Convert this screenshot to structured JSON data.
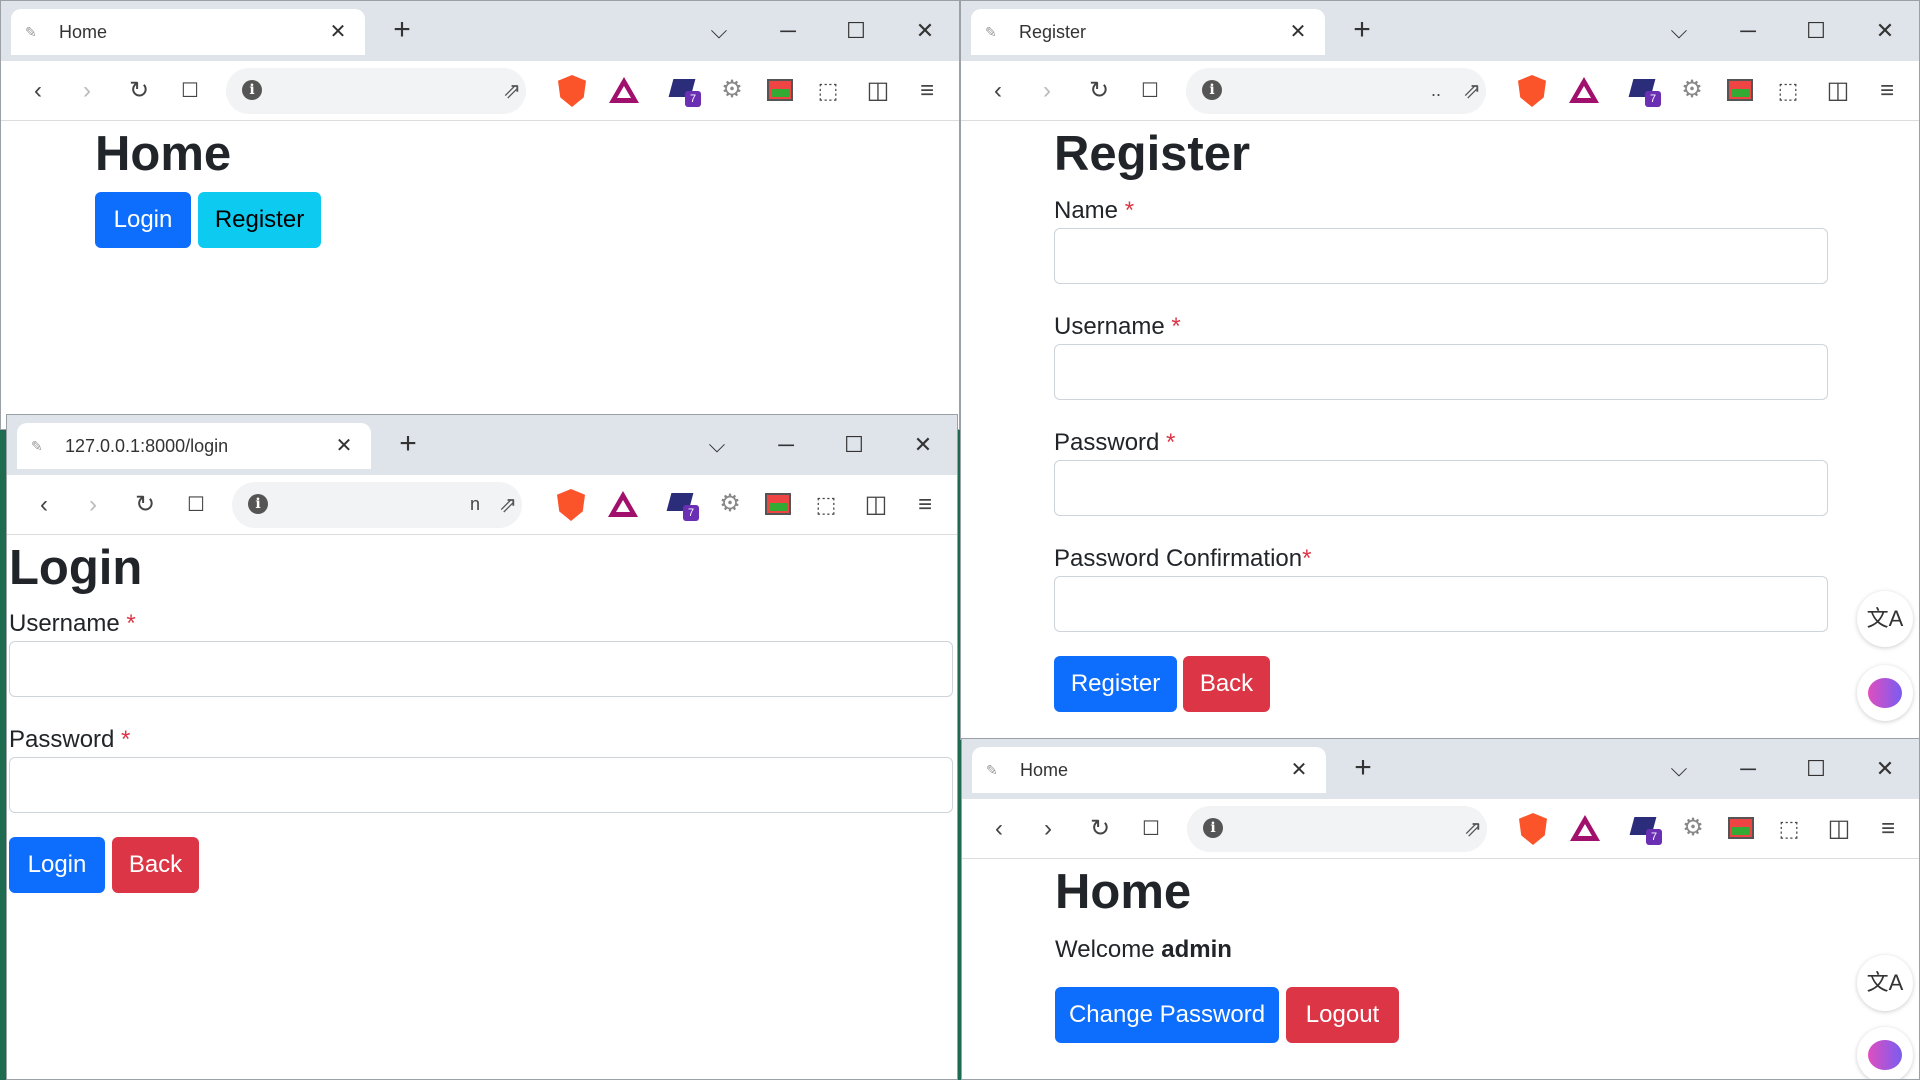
{
  "browser": {
    "new_tab": "+",
    "dropdown": "⌵",
    "minimize": "─",
    "maximize": "☐",
    "close": "✕",
    "back": "‹",
    "forward": "›",
    "reload": "↻",
    "bookmark": "🔖",
    "share": "⇗",
    "extensions": "⬚",
    "sidebar": "◫",
    "menu": "≡",
    "extension_badge": "7",
    "icons": [
      "info-icon",
      "share-icon",
      "brave-shields-icon",
      "bat-rewards-icon",
      "extension-icon",
      "gear-icon",
      "calendar-icon",
      "puzzle-icon",
      "sidebar-icon",
      "menu-icon"
    ]
  },
  "win_home_guest": {
    "tab_title": "Home",
    "omni_text": "",
    "heading": "Home",
    "login_label": "Login",
    "register_label": "Register"
  },
  "win_register": {
    "tab_title": "Register",
    "omni_text": "..",
    "heading": "Register",
    "fields": [
      {
        "label": "Name",
        "required": "*"
      },
      {
        "label": "Username",
        "required": "*"
      },
      {
        "label": "Password",
        "required": "*"
      },
      {
        "label": "Password Confirmation",
        "required": "*"
      }
    ],
    "register_label": "Register",
    "back_label": "Back"
  },
  "win_login": {
    "tab_title": "127.0.0.1:8000/login",
    "omni_text": "n",
    "heading": "Login",
    "fields": [
      {
        "label": "Username",
        "required": "*"
      },
      {
        "label": "Password",
        "required": "*"
      }
    ],
    "login_label": "Login",
    "back_label": "Back"
  },
  "win_home_user": {
    "tab_title": "Home",
    "omni_text": "",
    "heading": "Home",
    "welcome_prefix": "Welcome",
    "username": "admin",
    "change_password_label": "Change Password",
    "logout_label": "Logout"
  },
  "colors": {
    "primary": "#0d6efd",
    "info": "#0dcaf0",
    "danger": "#dc3545",
    "desktop": "#1e6b4f"
  }
}
